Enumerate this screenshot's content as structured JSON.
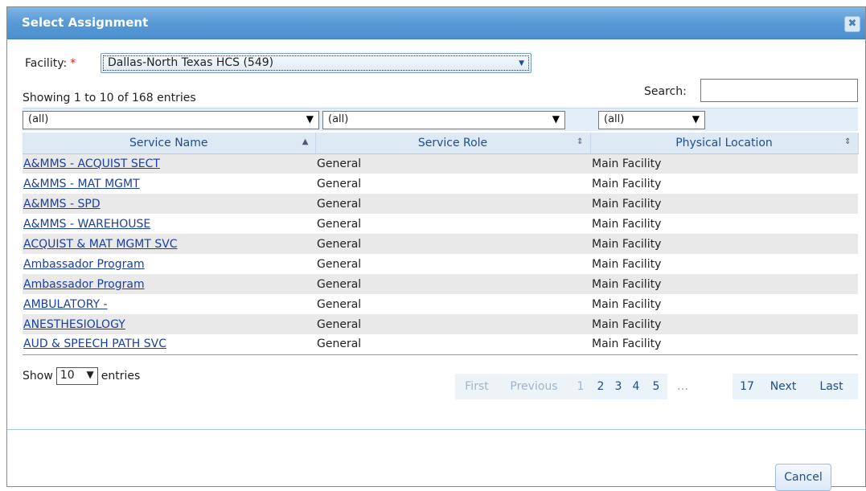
{
  "dialog": {
    "title": "Select Assignment",
    "close_glyph": "✖"
  },
  "facility": {
    "label": "Facility:",
    "required_mark": "*",
    "value": "Dallas-North Texas HCS (549)"
  },
  "table_info": "Showing 1 to 10 of 168 entries",
  "search": {
    "label": "Search:",
    "value": ""
  },
  "filters": [
    {
      "value": "(all)"
    },
    {
      "value": "(all)"
    },
    {
      "value": "(all)"
    }
  ],
  "columns": [
    {
      "label": "Service Name",
      "sort_icon": "▲"
    },
    {
      "label": "Service Role",
      "sort_icon": "⇕"
    },
    {
      "label": "Physical Location",
      "sort_icon": "⇕"
    }
  ],
  "rows": [
    {
      "service_name": "A&MMS - ACQUIST SECT",
      "service_role": "General",
      "physical_location": "Main Facility"
    },
    {
      "service_name": "A&MMS - MAT MGMT",
      "service_role": "General",
      "physical_location": "Main Facility"
    },
    {
      "service_name": "A&MMS - SPD",
      "service_role": "General",
      "physical_location": "Main Facility"
    },
    {
      "service_name": "A&MMS - WAREHOUSE",
      "service_role": "General",
      "physical_location": "Main Facility"
    },
    {
      "service_name": "ACQUIST & MAT MGMT SVC",
      "service_role": "General",
      "physical_location": "Main Facility"
    },
    {
      "service_name": "Ambassador Program",
      "service_role": "General",
      "physical_location": "Main Facility"
    },
    {
      "service_name": "Ambassador Program",
      "service_role": "General",
      "physical_location": "Main Facility"
    },
    {
      "service_name": "AMBULATORY -",
      "service_role": "General",
      "physical_location": "Main Facility"
    },
    {
      "service_name": "ANESTHESIOLOGY",
      "service_role": "General",
      "physical_location": "Main Facility"
    },
    {
      "service_name": "AUD & SPEECH PATH SVC",
      "service_role": "General",
      "physical_location": "Main Facility"
    }
  ],
  "length": {
    "prefix": "Show",
    "value": "10",
    "suffix": "entries"
  },
  "pagination": {
    "first": "First",
    "previous": "Previous",
    "pages": [
      "1",
      "2",
      "3",
      "4",
      "5"
    ],
    "ellipsis": "…",
    "last_page": "17",
    "next": "Next",
    "last": "Last",
    "current_page": 1
  },
  "footer": {
    "cancel_label": "Cancel"
  }
}
